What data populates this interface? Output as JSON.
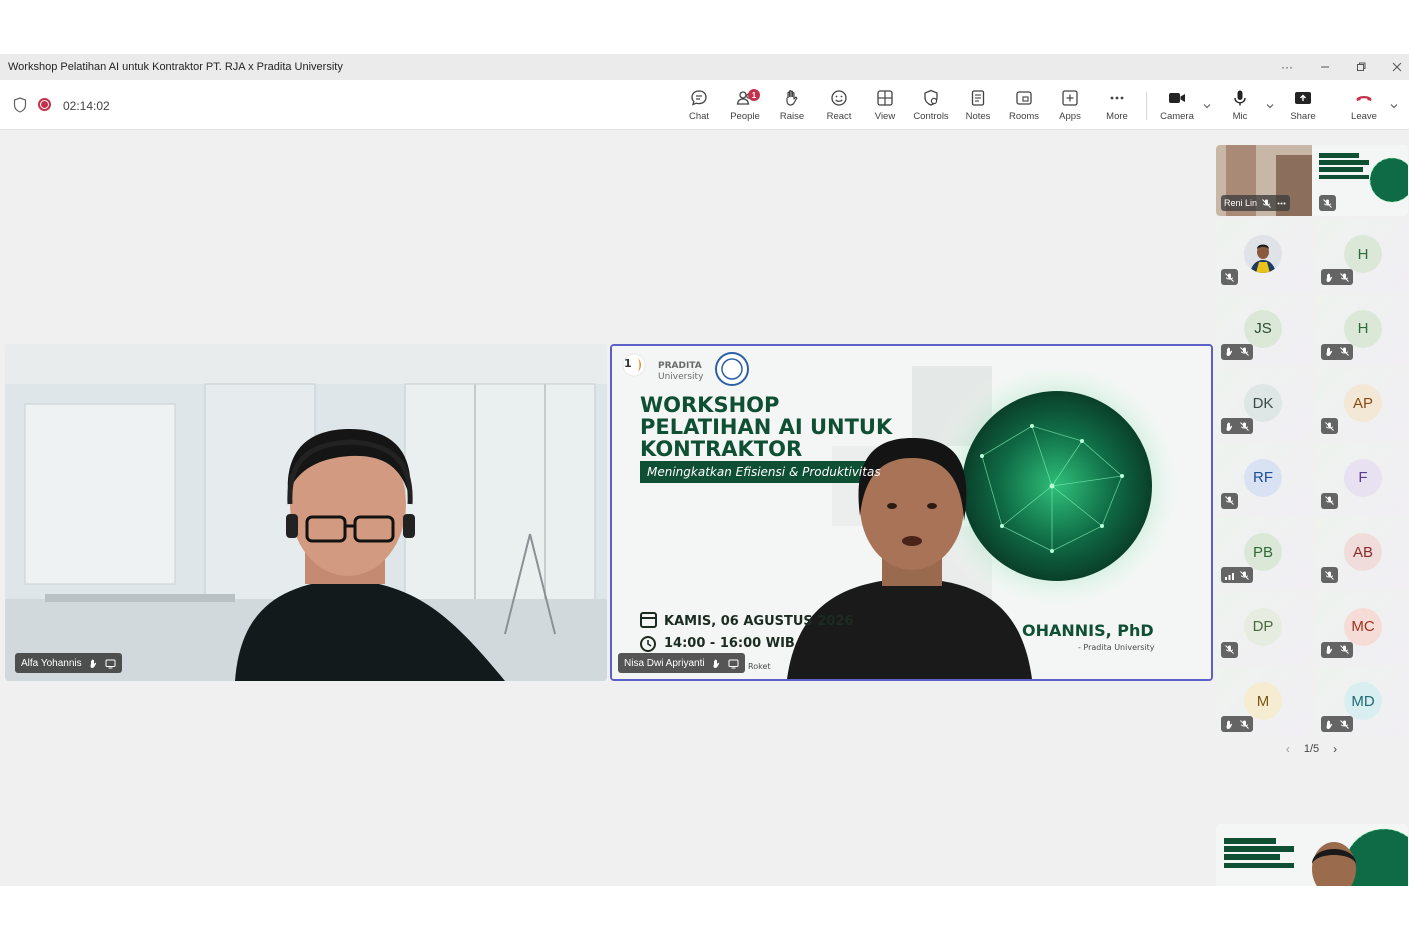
{
  "window": {
    "title": "Workshop Pelatihan AI untuk Kontraktor PT. RJA x Pradita University"
  },
  "meeting": {
    "timer": "02:14:02"
  },
  "toolbar": {
    "buttons": [
      {
        "label": "Chat",
        "icon": "chat-icon"
      },
      {
        "label": "People",
        "icon": "people-icon",
        "badge": "1"
      },
      {
        "label": "Raise",
        "icon": "raise-hand-icon"
      },
      {
        "label": "React",
        "icon": "react-icon"
      },
      {
        "label": "View",
        "icon": "view-icon"
      },
      {
        "label": "Controls",
        "icon": "controls-icon"
      },
      {
        "label": "Notes",
        "icon": "notes-icon"
      },
      {
        "label": "Rooms",
        "icon": "rooms-icon"
      },
      {
        "label": "Apps",
        "icon": "apps-icon"
      },
      {
        "label": "More",
        "icon": "more-icon"
      },
      {
        "label": "Camera",
        "icon": "camera-icon"
      },
      {
        "label": "Mic",
        "icon": "mic-icon"
      },
      {
        "label": "Share",
        "icon": "share-icon"
      },
      {
        "label": "Leave",
        "icon": "leave-icon"
      }
    ]
  },
  "stage": {
    "left_tile": {
      "name": "Alfa Yohannis"
    },
    "right_tile": {
      "name": "Nisa Dwi Apriyanti",
      "slide": {
        "badge_num": "1",
        "brand_line1": "PRADITA",
        "brand_line2": "University",
        "title1": "WORKSHOP",
        "title2": "PELATIHAN AI UNTUK",
        "title3": "KONTRAKTOR",
        "subtitle": "Meningkatkan Efisiensi & Produktivitas",
        "date": "KAMIS, 06 AGUSTUS 2026",
        "time": "14:00 - 16:00 WIB",
        "speaker_partial": "OHANNIS, PhD",
        "affiliation_partial": "- Pradita University",
        "footer_partial": "Roket"
      }
    }
  },
  "sidebar": {
    "top_tile": {
      "name": "Reni Lin"
    },
    "participants": [
      {
        "initials": "",
        "photo": true,
        "avatar_color": "#1e3a5f"
      },
      {
        "initials": "H",
        "avatar_color": "#dbe8d8",
        "text_color": "#2e6b3a"
      },
      {
        "initials": "JS",
        "avatar_color": "#dbe8d8",
        "text_color": "#2e4b2e"
      },
      {
        "initials": "H",
        "avatar_color": "#dbe8d8",
        "text_color": "#2e6b3a"
      },
      {
        "initials": "DK",
        "avatar_color": "#dfe6e6",
        "text_color": "#3b4b4b"
      },
      {
        "initials": "AP",
        "avatar_color": "#f3e7d6",
        "text_color": "#8a4b12"
      },
      {
        "initials": "RF",
        "avatar_color": "#d9e2f2",
        "text_color": "#1f4b99"
      },
      {
        "initials": "F",
        "avatar_color": "#e8e1f1",
        "text_color": "#5b3d8a"
      },
      {
        "initials": "PB",
        "avatar_color": "#dbe8d8",
        "text_color": "#2e6b3a"
      },
      {
        "initials": "AB",
        "avatar_color": "#f1dcdc",
        "text_color": "#8a2a2a"
      },
      {
        "initials": "DP",
        "avatar_color": "#e6ecdf",
        "text_color": "#4b6b3a"
      },
      {
        "initials": "MC",
        "avatar_color": "#f6dcd6",
        "text_color": "#a0331f"
      },
      {
        "initials": "M",
        "avatar_color": "#f6ecd2",
        "text_color": "#7a5a12"
      },
      {
        "initials": "MD",
        "avatar_color": "#d8eef0",
        "text_color": "#1f6b75"
      }
    ],
    "pager": "1/5"
  }
}
